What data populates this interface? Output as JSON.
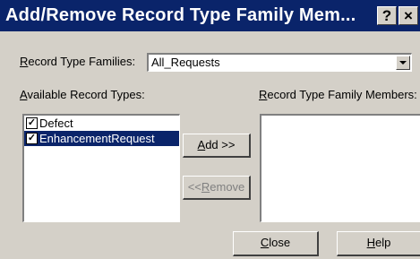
{
  "window": {
    "title": "Add/Remove Record Type Family Mem...",
    "help_button": "?",
    "close_button": "×"
  },
  "families": {
    "label_accel": "R",
    "label_rest": "ecord Type Families:",
    "selected_value": "All_Requests"
  },
  "available": {
    "label_accel": "A",
    "label_rest": "vailable Record Types:",
    "items": [
      {
        "label": "Defect",
        "checked": true,
        "selected": false
      },
      {
        "label": "EnhancementRequest",
        "checked": true,
        "selected": true
      }
    ]
  },
  "members": {
    "label_accel": "R",
    "label_rest": "ecord Type Family Members:",
    "items": []
  },
  "buttons": {
    "add_accel": "A",
    "add_rest": "dd >>",
    "remove_prefix": "<<",
    "remove_accel": "R",
    "remove_rest": "emove",
    "close_accel": "C",
    "close_rest": "lose",
    "help_accel": "H",
    "help_rest": "elp"
  },
  "colors": {
    "dialog_bg": "#d4d0c8",
    "titlebar_bg": "#0a246a",
    "selection_bg": "#0a246a"
  }
}
